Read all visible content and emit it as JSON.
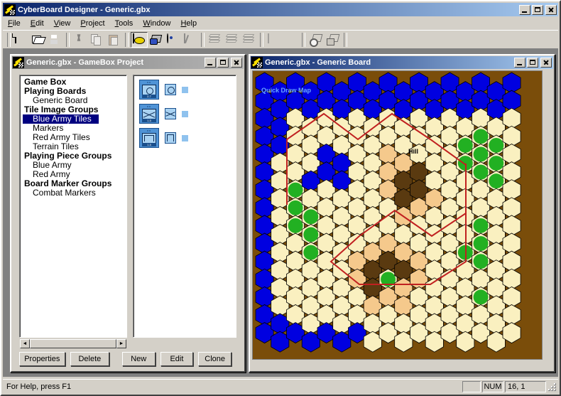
{
  "app": {
    "title": "CyberBoard Designer - Generic.gbx",
    "icon": "cyberboard-icon"
  },
  "window_buttons": {
    "minimize": "minimize-button",
    "maximize": "maximize-button",
    "close": "close-button"
  },
  "menubar": {
    "items": [
      {
        "label": "File",
        "accel": "F"
      },
      {
        "label": "Edit",
        "accel": "E"
      },
      {
        "label": "View",
        "accel": "V"
      },
      {
        "label": "Project",
        "accel": "P"
      },
      {
        "label": "Tools",
        "accel": "T"
      },
      {
        "label": "Window",
        "accel": "W"
      },
      {
        "label": "Help",
        "accel": "H"
      }
    ]
  },
  "toolbar": {
    "buttons": [
      {
        "name": "new-icon",
        "tip": "New",
        "enabled": true,
        "active": false
      },
      {
        "name": "open-icon",
        "tip": "Open",
        "enabled": true,
        "active": false
      },
      {
        "name": "save-icon",
        "tip": "Save",
        "enabled": true,
        "active": false
      },
      {
        "name": "cut-icon",
        "tip": "Cut",
        "enabled": false,
        "active": false
      },
      {
        "name": "copy-icon",
        "tip": "Copy",
        "enabled": false,
        "active": false
      },
      {
        "name": "paste-icon",
        "tip": "Paste",
        "enabled": false,
        "active": false
      },
      {
        "name": "board-editor-icon",
        "tip": "Board Editor",
        "enabled": true,
        "active": true
      },
      {
        "name": "tile-manager-icon",
        "tip": "Tile Manager",
        "enabled": true,
        "active": false
      },
      {
        "name": "color-palette-icon",
        "tip": "Color Palette",
        "enabled": true,
        "active": false
      },
      {
        "name": "marker-palette-icon",
        "tip": "Marker Palette",
        "enabled": false,
        "active": false
      },
      {
        "name": "layer-base-icon",
        "tip": "Base Layer",
        "enabled": false,
        "active": false
      },
      {
        "name": "layer-tile-icon",
        "tip": "Tile Layer",
        "enabled": false,
        "active": false
      },
      {
        "name": "layer-top-icon",
        "tip": "Top Layer",
        "enabled": false,
        "active": false
      },
      {
        "name": "grid-lines-icon",
        "tip": "Grid Lines",
        "enabled": false,
        "active": false
      },
      {
        "name": "grid-dots-icon",
        "tip": "Grid Dots",
        "enabled": false,
        "active": false
      },
      {
        "name": "select-tool-icon",
        "tip": "Select",
        "enabled": true,
        "active": false
      },
      {
        "name": "select-area-icon",
        "tip": "Select Area",
        "enabled": true,
        "active": false
      }
    ]
  },
  "project_window": {
    "title": "Generic.gbx - GameBox Project",
    "icon": "gamebox-icon",
    "active": false,
    "tree": [
      {
        "label": "Game Box",
        "level": 0,
        "selected": false
      },
      {
        "label": "Playing Boards",
        "level": 0,
        "selected": false
      },
      {
        "label": "Generic Board",
        "level": 1,
        "selected": false
      },
      {
        "label": "Tile Image Groups",
        "level": 0,
        "selected": false
      },
      {
        "label": "Blue Army Tiles",
        "level": 1,
        "selected": true
      },
      {
        "label": "Markers",
        "level": 1,
        "selected": false
      },
      {
        "label": "Red Army Tiles",
        "level": 1,
        "selected": false
      },
      {
        "label": "Terrain Tiles",
        "level": 1,
        "selected": false
      },
      {
        "label": "Playing Piece Groups",
        "level": 0,
        "selected": false
      },
      {
        "label": "Blue Army",
        "level": 1,
        "selected": false
      },
      {
        "label": "Red Army",
        "level": 1,
        "selected": false
      },
      {
        "label": "Board Marker Groups",
        "level": 0,
        "selected": false
      },
      {
        "label": "Combat Markers",
        "level": 1,
        "selected": false
      }
    ],
    "tiles": [
      {
        "name": "tile-blue-armor-2-7",
        "top": "xx",
        "bottom": "2-7",
        "symbol": "oval"
      },
      {
        "name": "tile-blue-infantry-1-5",
        "top": "xx",
        "bottom": "1-5",
        "symbol": "cross"
      },
      {
        "name": "tile-blue-mech-1-5",
        "top": "xx",
        "bottom": "1-5",
        "symbol": "round"
      }
    ],
    "buttons": {
      "properties": "Properties",
      "delete": "Delete",
      "new": "New",
      "edit": "Edit",
      "clone": "Clone"
    },
    "scroll": {
      "left_arrow": "◄",
      "right_arrow": "►"
    }
  },
  "board_window": {
    "title": "Generic.gbx - Generic Board",
    "icon": "board-icon",
    "active": true,
    "map_label": "Quick Draw Map",
    "hill_label": "Hill"
  },
  "statusbar": {
    "help_text": "For Help, press F1",
    "num_lock": "NUM",
    "coordinates": "16, 1"
  },
  "colors": {
    "title_active_start": "#0a246a",
    "title_active_end": "#a6caf0",
    "title_inactive_start": "#808080",
    "face": "#d4d0c8",
    "selection": "#000080",
    "map_background": "#7a4d0a",
    "hex_water": "#0000e0",
    "hex_clear": "#faf0c0",
    "hex_rough": "#f5c98c",
    "hex_hill": "#5a3a10",
    "hex_woods": "#22b022",
    "boundary_line": "#c02020"
  }
}
